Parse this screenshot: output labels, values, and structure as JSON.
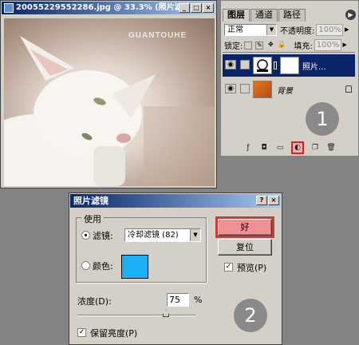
{
  "doc_window": {
    "title": "20055229552286.jpg @ 33.3% (照片滤镜 ...",
    "watermark": "GUANTOUHE",
    "buttons": [
      "_",
      "□",
      "×"
    ]
  },
  "layers_panel": {
    "tabs": [
      "图层",
      "通道",
      "路径"
    ],
    "blend_mode": "正常",
    "opacity_label": "不透明度:",
    "opacity_value": "100%",
    "lock_label": "锁定:",
    "fill_label": "填充:",
    "fill_value": "100%",
    "layers": [
      {
        "name": "照片...",
        "selected": true
      },
      {
        "name": "背景",
        "selected": false
      }
    ],
    "step_badge": "1"
  },
  "dialog": {
    "title": "照片滤镜",
    "group_label": "使用",
    "filter_label": "滤镜:",
    "filter_value": "冷却滤镜 (82)",
    "color_label": "颜色:",
    "swatch_color": "#1eb0f5",
    "ok_label": "好",
    "reset_label": "复位",
    "preview_label": "预览(P)",
    "density_label": "浓度(D):",
    "density_value": "75",
    "density_unit": "%",
    "density_level": 75,
    "preserve_label": "保留亮度(P)",
    "step_badge": "2"
  }
}
